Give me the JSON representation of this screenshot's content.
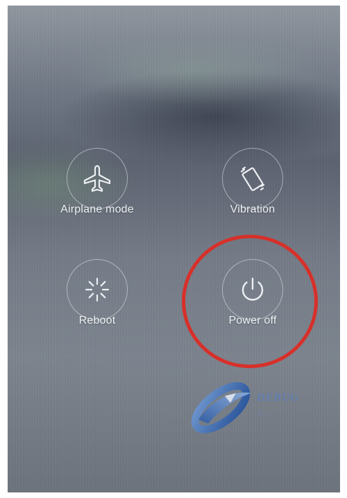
{
  "power_menu": {
    "items": [
      {
        "id": "airplane",
        "label": "Airplane mode",
        "icon": "airplane-icon"
      },
      {
        "id": "vibration",
        "label": "Vibration",
        "icon": "vibration-phone-icon"
      },
      {
        "id": "reboot",
        "label": "Reboot",
        "icon": "reboot-icon"
      },
      {
        "id": "poweroff",
        "label": "Power off",
        "icon": "power-icon"
      }
    ]
  },
  "annotation": {
    "highlight_color": "#d7302a",
    "highlight_target": "poweroff"
  },
  "watermark": {
    "text": "DEBUG",
    "subtext": "C...",
    "logo_icon": "swoosh-logo"
  },
  "colors": {
    "label_text": "#eef0f3",
    "icon_stroke": "#eef0f3",
    "ring": "rgba(230,232,236,0.55)"
  }
}
